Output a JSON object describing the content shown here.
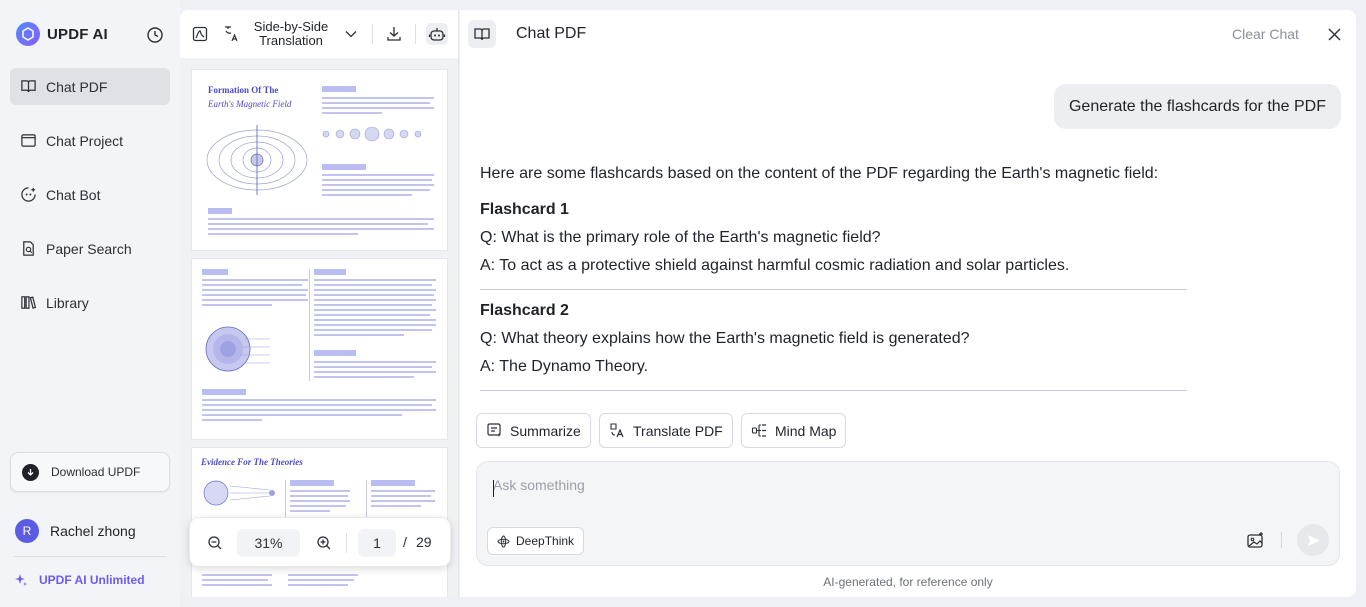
{
  "sidebar": {
    "brand": "UPDF AI",
    "items": [
      {
        "label": "Chat PDF",
        "icon": "book-open-icon"
      },
      {
        "label": "Chat Project",
        "icon": "folder-chat-icon"
      },
      {
        "label": "Chat Bot",
        "icon": "bot-icon"
      },
      {
        "label": "Paper Search",
        "icon": "paper-search-icon"
      },
      {
        "label": "Library",
        "icon": "library-icon"
      }
    ],
    "download_label": "Download UPDF",
    "user": {
      "initial": "R",
      "name": "Rachel zhong"
    },
    "plan_label": "UPDF AI Unlimited"
  },
  "pdf": {
    "mode_label_line1": "Side-by-Side",
    "mode_label_line2": "Translation",
    "pages": [
      {
        "title": "Formation Of The",
        "subtitle": "Earth's Magnetic Field"
      },
      {
        "title": "",
        "subtitle": ""
      },
      {
        "title": "Evidence For The Theories",
        "subtitle": ""
      }
    ],
    "zoom": "31%",
    "current_page": "1",
    "page_separator": "/",
    "total_pages": "29"
  },
  "chat": {
    "title": "Chat PDF",
    "clear_label": "Clear Chat",
    "user_message": "Generate the flashcards for the PDF",
    "intro": "Here are some flashcards based on the content of the PDF regarding the Earth's magnetic field:",
    "flashcards": [
      {
        "heading": "Flashcard 1",
        "question": "Q: What is the primary role of the Earth's magnetic field?",
        "answer": "A: To act as a protective shield against harmful cosmic radiation and solar particles."
      },
      {
        "heading": "Flashcard 2",
        "question": "Q: What theory explains how the Earth's magnetic field is generated?",
        "answer": "A: The Dynamo Theory."
      }
    ],
    "actions": [
      "Summarize",
      "Translate PDF",
      "Mind Map"
    ],
    "input_placeholder": "Ask something",
    "deepthink_label": "DeepThink",
    "disclaimer": "AI-generated, for reference only"
  },
  "colors": {
    "accent": "#6a5cf0",
    "active_nav": "#dfe1e7",
    "avatar": "#5b5ce2"
  }
}
